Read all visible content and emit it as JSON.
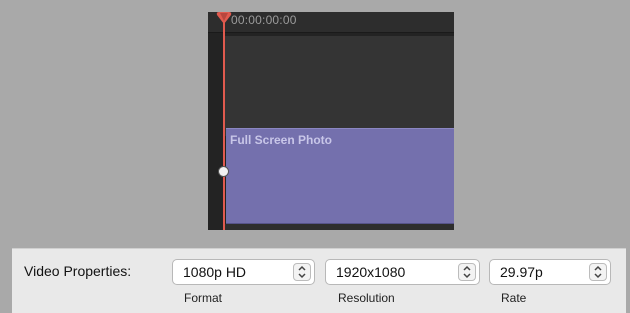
{
  "timeline": {
    "timecode": "00:00:00:00",
    "clip_title": "Full Screen Photo"
  },
  "properties": {
    "label": "Video Properties:",
    "format": {
      "value": "1080p HD",
      "caption": "Format"
    },
    "resolution": {
      "value": "1920x1080",
      "caption": "Resolution"
    },
    "rate": {
      "value": "29.97p",
      "caption": "Rate"
    }
  },
  "colors": {
    "clip": "#7470ad",
    "playhead": "#e05a4e",
    "timeline_bg": "#232323"
  },
  "icons": [
    "playhead-marker-icon",
    "clip-handle-icon",
    "stepper-chevrons-icon"
  ]
}
